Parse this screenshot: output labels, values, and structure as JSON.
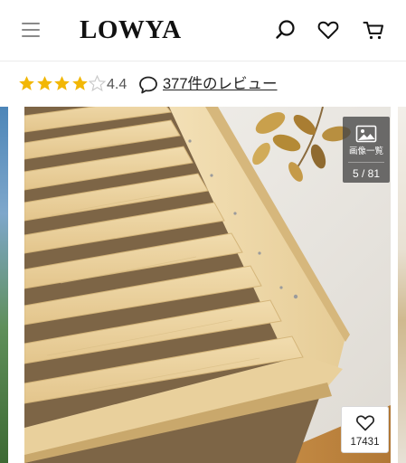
{
  "header": {
    "logo_text": "LOWYA",
    "menu_icon": "hamburger-menu-icon",
    "search_icon": "search-icon",
    "favorite_icon": "heart-icon",
    "cart_icon": "cart-icon"
  },
  "rating": {
    "stars_filled": 4,
    "stars_total": 5,
    "value": "4.4",
    "review_link": "377件のレビュー",
    "star_color": "#f2b705"
  },
  "gallery": {
    "label": "画像一覧",
    "counter": "5 / 81",
    "icon": "image-gallery-icon"
  },
  "favorite": {
    "count": "17431",
    "icon": "heart-outline-icon"
  },
  "colors": {
    "text": "#222222",
    "wood": "#e8cf9b",
    "overlay": "#464646"
  }
}
